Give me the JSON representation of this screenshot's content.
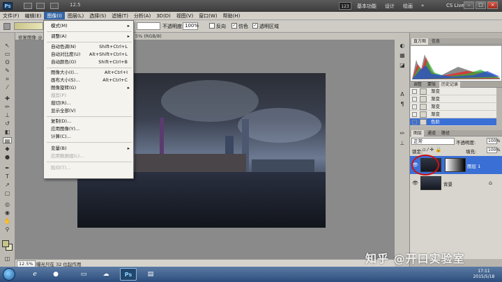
{
  "titlebar": {
    "zoom": "12.5",
    "badge": "123",
    "workspaces": [
      "基本功能",
      "设计",
      "绘画"
    ],
    "more": "»",
    "cs_live": "CS Live",
    "win_min": "–",
    "win_max": "□",
    "win_close": "×"
  },
  "menubar": [
    "文件(F)",
    "编辑(E)",
    "图像(I)",
    "图层(L)",
    "选择(S)",
    "滤镜(T)",
    "分析(A)",
    "3D(D)",
    "视图(V)",
    "窗口(W)",
    "帮助(H)"
  ],
  "options": {
    "mode_value": "",
    "opacity_label": "不透明度:",
    "opacity_value": "100%",
    "reverse_label": "反向",
    "dither_label": "仿色",
    "transparency_label": "透明区域"
  },
  "document": {
    "tab_label": "修复图像 @",
    "tab_tail": "5% (RGB/8)",
    "status_zoom": "12.5%",
    "status_msg": "曝光只在 32 位起作用"
  },
  "image_menu": [
    {
      "label": "模式(M)",
      "shortcut": "",
      "submenu": true,
      "disabled": false
    },
    {
      "label": "调整(A)",
      "shortcut": "",
      "submenu": true,
      "disabled": false
    },
    {
      "label": "自动色调(N)",
      "shortcut": "Shift+Ctrl+L",
      "submenu": false,
      "disabled": false
    },
    {
      "label": "自动对比度(U)",
      "shortcut": "Alt+Shift+Ctrl+L",
      "submenu": false,
      "disabled": false
    },
    {
      "label": "自动颜色(O)",
      "shortcut": "Shift+Ctrl+B",
      "submenu": false,
      "disabled": false
    },
    {
      "label": "图像大小(I)...",
      "shortcut": "Alt+Ctrl+I",
      "submenu": false,
      "disabled": false
    },
    {
      "label": "画布大小(S)...",
      "shortcut": "Alt+Ctrl+C",
      "submenu": false,
      "disabled": false
    },
    {
      "label": "图像旋转(G)",
      "shortcut": "",
      "submenu": true,
      "disabled": false
    },
    {
      "label": "裁剪(P)",
      "shortcut": "",
      "submenu": false,
      "disabled": true
    },
    {
      "label": "裁切(R)...",
      "shortcut": "",
      "submenu": false,
      "disabled": false
    },
    {
      "label": "显示全部(V)",
      "shortcut": "",
      "submenu": false,
      "disabled": false
    },
    {
      "label": "复制(D)...",
      "shortcut": "",
      "submenu": false,
      "disabled": false
    },
    {
      "label": "应用图像(Y)...",
      "shortcut": "",
      "submenu": false,
      "disabled": false
    },
    {
      "label": "计算(C)...",
      "shortcut": "",
      "submenu": false,
      "disabled": false
    },
    {
      "label": "变量(B)",
      "shortcut": "",
      "submenu": true,
      "disabled": false
    },
    {
      "label": "应用数据组(L)...",
      "shortcut": "",
      "submenu": false,
      "disabled": true
    },
    {
      "label": "陷印(T)...",
      "shortcut": "",
      "submenu": false,
      "disabled": true
    }
  ],
  "panels": {
    "histogram_tabs": [
      "直方图",
      "信息"
    ],
    "history_tabs": [
      "调整",
      "蒙版",
      "历史记录"
    ],
    "history_items": [
      "渐变",
      "渐变",
      "渐变",
      "渐变",
      "色阶"
    ],
    "layer_tabs": [
      "图层",
      "通道",
      "路径"
    ],
    "blend_mode": "正常",
    "opacity_label": "不透明度:",
    "opacity_value": "100%",
    "lock_label": "锁定:",
    "fill_label": "填充:",
    "fill_value": "100%",
    "layers": [
      {
        "name": "图层 1",
        "selected": true
      },
      {
        "name": "背景",
        "selected": false
      }
    ]
  },
  "taskbar": {
    "ps_label": "Ps",
    "time": "17:11",
    "date": "2015/5/18"
  },
  "watermark": "知乎 @开口实验室"
}
